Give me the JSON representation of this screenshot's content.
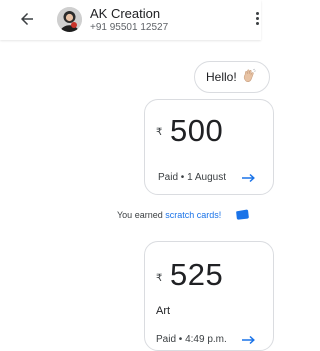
{
  "header": {
    "contact_name": "AK Creation",
    "contact_phone": "+91 95501 12527",
    "back_icon": "back-arrow-icon",
    "more_icon": "more-vert-icon"
  },
  "messages": {
    "hello_text": "Hello!",
    "hello_emoji": "waving-hand-icon"
  },
  "payments": [
    {
      "currency_symbol": "₹",
      "amount": "500",
      "note": "",
      "status": "Paid • 1 August"
    },
    {
      "currency_symbol": "₹",
      "amount": "525",
      "note": "Art",
      "status": "Paid • 4:49 p.m."
    }
  ],
  "reward": {
    "prefix": "You earned ",
    "link_text": "scratch cards!",
    "icon": "scratch-card-icon"
  },
  "colors": {
    "accent": "#1a73e8",
    "card_border": "#dadce0",
    "text_primary": "#202124",
    "text_secondary": "#5f6368"
  }
}
